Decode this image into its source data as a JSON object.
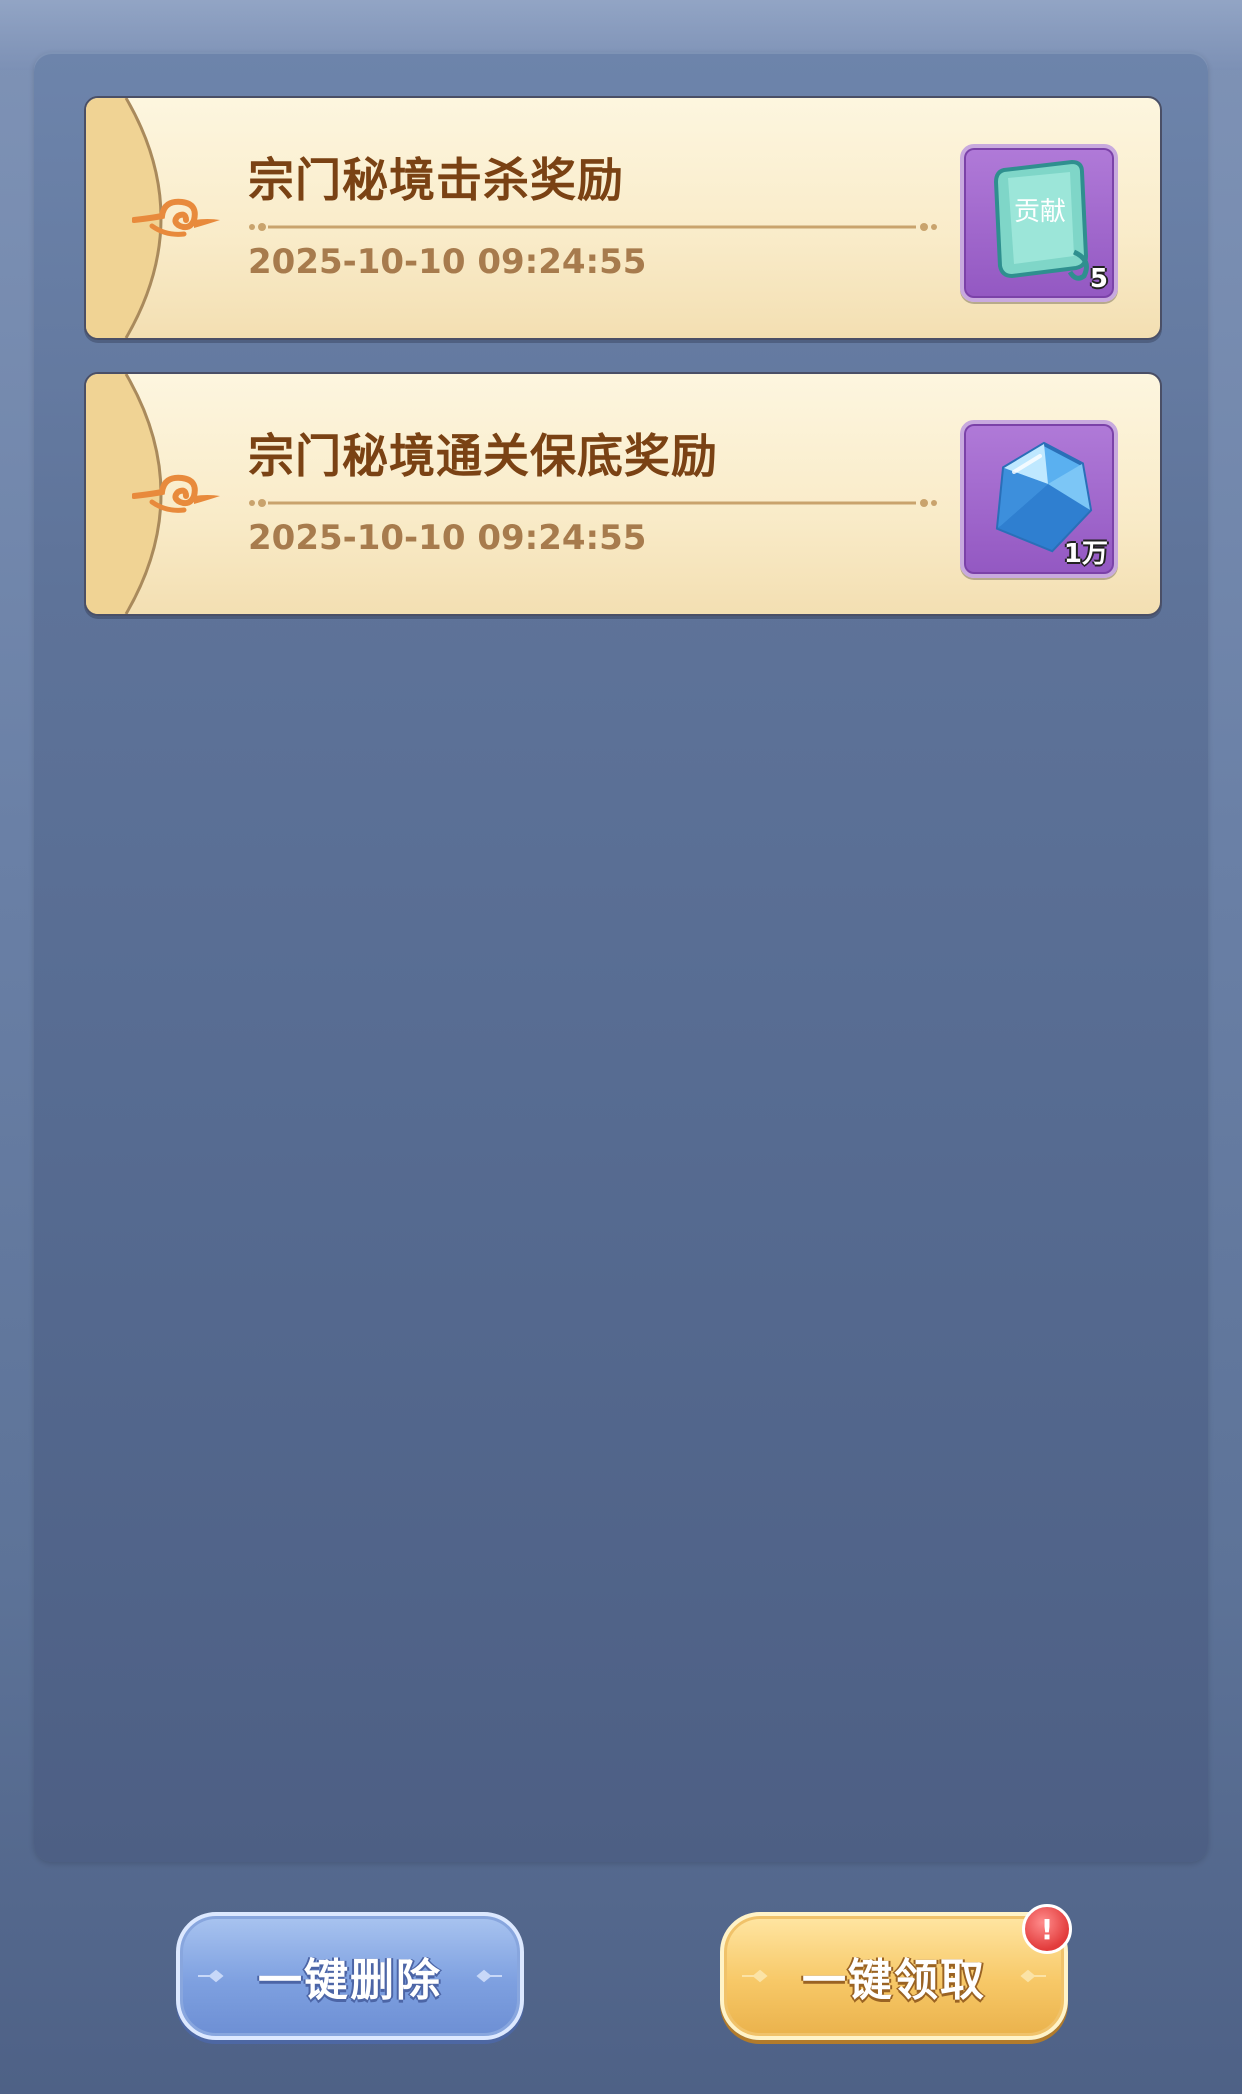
{
  "mails": [
    {
      "title": "宗门秘境击杀奖励",
      "time": "2025-10-10 09:24:55",
      "reward": {
        "icon": "contribution-token-icon",
        "count": "5",
        "text": "贡献"
      }
    },
    {
      "title": "宗门秘境通关保底奖励",
      "time": "2025-10-10 09:24:55",
      "reward": {
        "icon": "blue-crystal-icon",
        "count": "1万"
      }
    }
  ],
  "buttons": {
    "delete_all": "一键删除",
    "claim_all": "一键领取",
    "claim_alert": "!"
  },
  "colors": {
    "panel": "#5e7399",
    "card": "#f9ebc8",
    "title_text": "#7a4214",
    "time_text": "#a77b4d",
    "reward_bg": "#9358c2",
    "delete_button": "#7ea0e0",
    "claim_button": "#f7c867",
    "alert": "#e23b3b"
  }
}
